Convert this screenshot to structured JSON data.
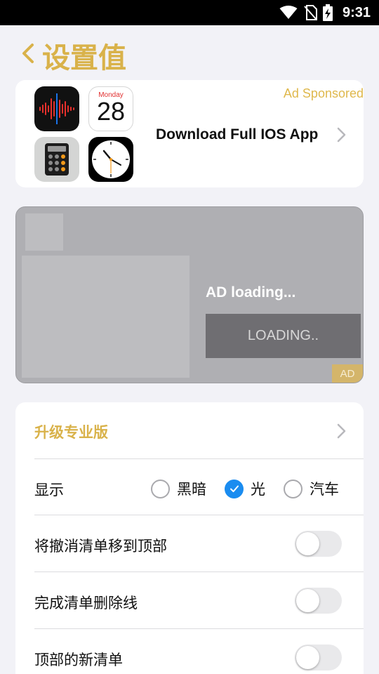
{
  "status_bar": {
    "time": "9:31"
  },
  "header": {
    "title": "设置值"
  },
  "promo": {
    "sponsored_label": "Ad Sponsored",
    "cta_text": "Download Full IOS App",
    "calendar_day": "Monday",
    "calendar_date": "28",
    "icons": [
      "voice-memos-icon",
      "calendar-icon",
      "calculator-icon",
      "clock-icon"
    ]
  },
  "ad": {
    "loading_text": "AD loading...",
    "button_label": "LOADING..",
    "tag": "AD"
  },
  "settings": {
    "upgrade_label": "升级专业版",
    "display": {
      "label": "显示",
      "options": [
        "黑暗",
        "光",
        "汽车"
      ],
      "selected": "光"
    },
    "toggles": [
      {
        "label": "将撤消清单移到顶部",
        "on": false
      },
      {
        "label": "完成清单删除线",
        "on": false
      },
      {
        "label": "顶部的新清单",
        "on": false
      }
    ]
  },
  "colors": {
    "accent": "#d9b24a",
    "radio_selected": "#1a8cf0",
    "ad_background": "#afafb3"
  }
}
